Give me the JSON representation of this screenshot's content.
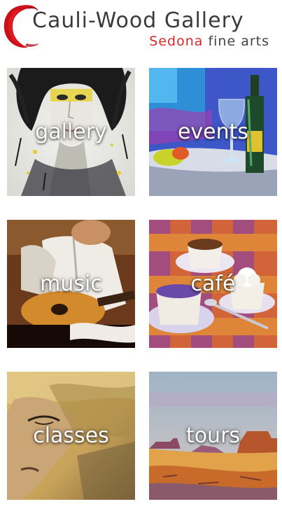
{
  "header": {
    "title": "Cauli-Wood Gallery",
    "subtitle_city": "Sedona",
    "subtitle_rest": "fine arts"
  },
  "tiles": [
    {
      "label": "gallery"
    },
    {
      "label": "events"
    },
    {
      "label": "music"
    },
    {
      "label": "café"
    },
    {
      "label": "classes"
    },
    {
      "label": "tours"
    }
  ]
}
